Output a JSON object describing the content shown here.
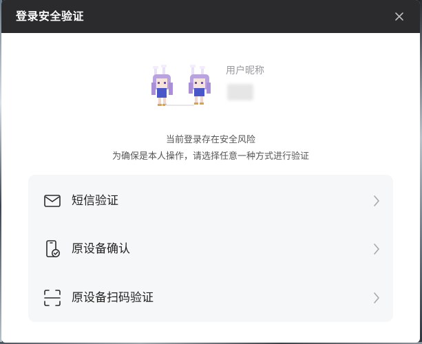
{
  "dialog": {
    "title": "登录安全验证",
    "close_icon": "close-icon"
  },
  "profile": {
    "nickname": "用户昵称",
    "avatar_icon": "pixel-bunny-girls-avatar"
  },
  "notice": {
    "line1": "当前登录存在安全风险",
    "line2": "为确保是本人操作，请选择任意一种方式进行验证"
  },
  "options": [
    {
      "label": "短信验证",
      "icon": "envelope-icon"
    },
    {
      "label": "原设备确认",
      "icon": "phone-check-icon"
    },
    {
      "label": "原设备扫码验证",
      "icon": "scan-icon"
    }
  ],
  "colors": {
    "titlebar": "#2b2b2d",
    "panel": "#f6f7f8",
    "avatar_purple": "#b9a2e0"
  }
}
